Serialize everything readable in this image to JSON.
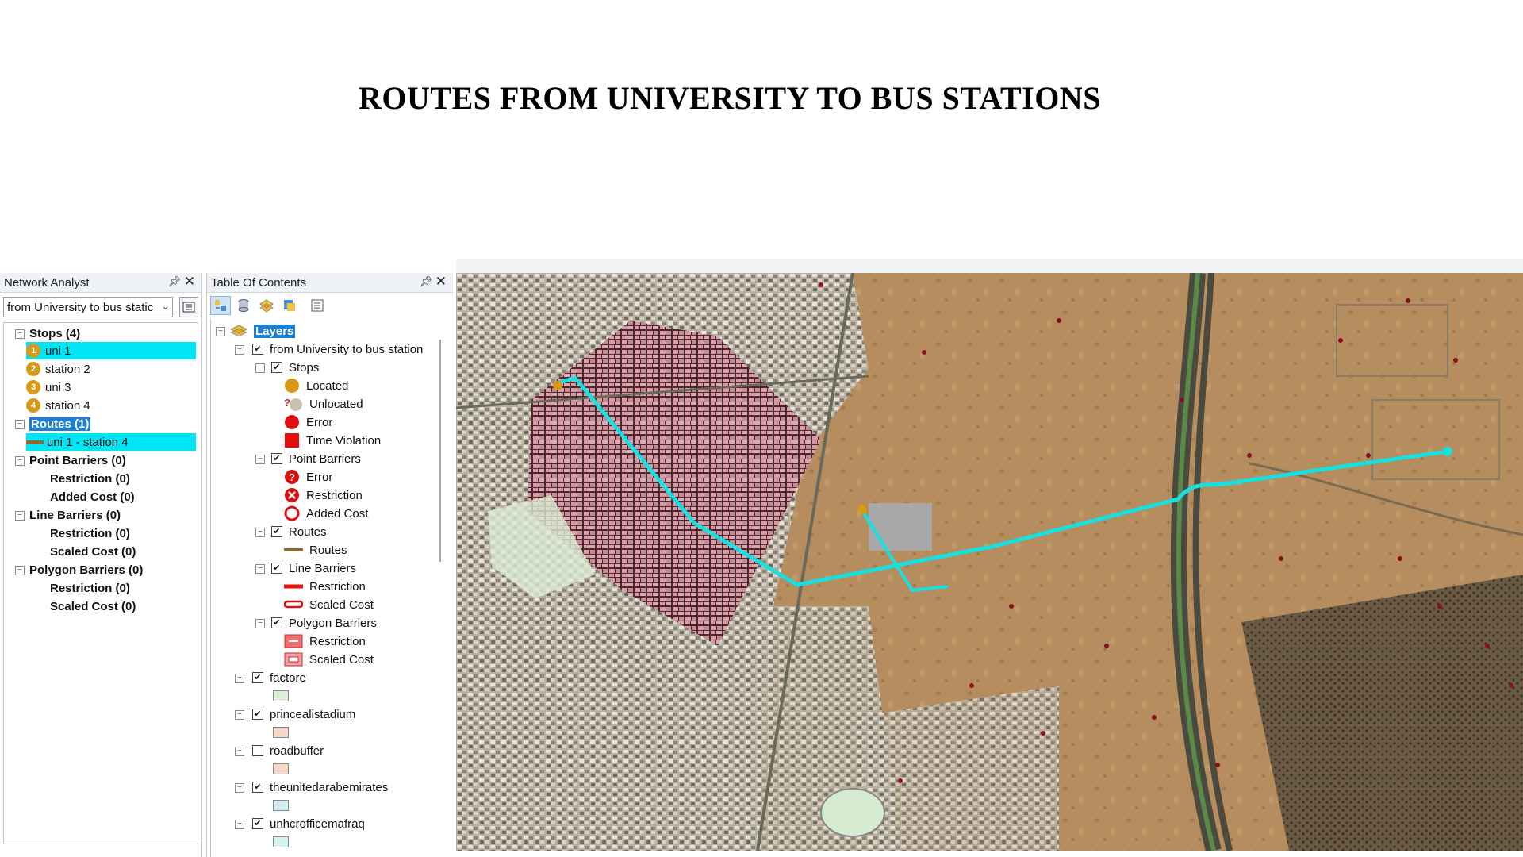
{
  "slide_title": "ROUTES FROM UNIVERSITY TO BUS STATIONS",
  "network_analyst": {
    "title": "Network Analyst",
    "selected_analysis": "from University to bus static",
    "tree": [
      {
        "label": "Stops (4)",
        "type": "group"
      },
      {
        "label": "uni 1",
        "num": "1",
        "selected": true
      },
      {
        "label": "station 2",
        "num": "2"
      },
      {
        "label": "uni 3",
        "num": "3"
      },
      {
        "label": "station 4",
        "num": "4"
      },
      {
        "label": "Routes (1)",
        "type": "group",
        "highlight": true
      },
      {
        "label": "uni 1 - station 4",
        "selected": true
      },
      {
        "label": "Point Barriers (0)",
        "type": "group"
      },
      {
        "label": "Restriction (0)",
        "type": "sub"
      },
      {
        "label": "Added Cost (0)",
        "type": "sub"
      },
      {
        "label": "Line Barriers (0)",
        "type": "group"
      },
      {
        "label": "Restriction (0)",
        "type": "sub"
      },
      {
        "label": "Scaled Cost (0)",
        "type": "sub"
      },
      {
        "label": "Polygon Barriers (0)",
        "type": "group"
      },
      {
        "label": "Restriction (0)",
        "type": "sub"
      },
      {
        "label": "Scaled Cost (0)",
        "type": "sub"
      }
    ]
  },
  "toc": {
    "title": "Table Of Contents",
    "root": "Layers",
    "layer_group": "from University to bus station",
    "stops": "Stops",
    "stop_items": [
      "Located",
      "Unlocated",
      "Error",
      "Time Violation"
    ],
    "point_barriers": "Point Barriers",
    "pb_items": [
      "Error",
      "Restriction",
      "Added Cost"
    ],
    "routes": "Routes",
    "route_items": [
      "Routes"
    ],
    "line_barriers": "Line Barriers",
    "lb_items": [
      "Restriction",
      "Scaled Cost"
    ],
    "polygon_barriers": "Polygon Barriers",
    "pgb_items": [
      "Restriction",
      "Scaled Cost"
    ],
    "layers": [
      {
        "name": "factore",
        "checked": true,
        "color": "#dcf0d8"
      },
      {
        "name": "princealistadium",
        "checked": true,
        "color": "#f6d8c8"
      },
      {
        "name": "roadbuffer",
        "checked": false,
        "color": "#f6d8c8"
      },
      {
        "name": "theunitedarabemirates",
        "checked": true,
        "color": "#d4eef4"
      },
      {
        "name": "unhcrofficemafraq",
        "checked": true,
        "color": "#d6f2ee"
      }
    ]
  },
  "colors": {
    "route": "#19e0e0",
    "stop": "#d69a18",
    "selection": "#00e5f5",
    "buildings": "#d99aa6"
  }
}
